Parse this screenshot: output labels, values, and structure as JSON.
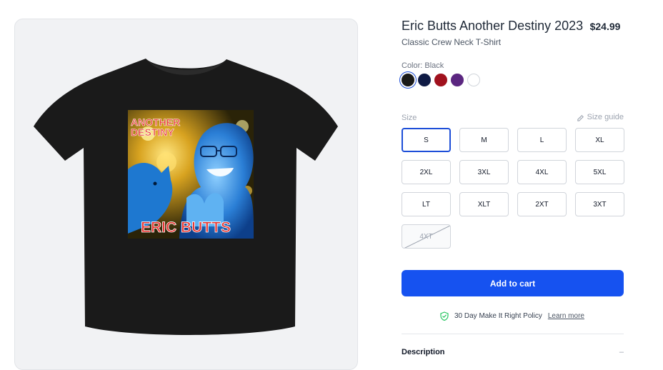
{
  "product": {
    "title": "Eric Butts Another Destiny 2023",
    "price": "$24.99",
    "subtitle": "Classic Crew Neck T-Shirt",
    "image_alt_text": "ANOTHER DESTINY / ERIC BUTTS shirt print"
  },
  "color": {
    "label": "Color: Black",
    "swatches": [
      {
        "name": "Black",
        "hex": "#1a1a1a",
        "selected": true
      },
      {
        "name": "Navy",
        "hex": "#0f1b45",
        "selected": false
      },
      {
        "name": "Red",
        "hex": "#a0111d",
        "selected": false
      },
      {
        "name": "Purple",
        "hex": "#5b2680",
        "selected": false
      },
      {
        "name": "White",
        "hex": "#ffffff",
        "selected": false
      }
    ]
  },
  "size": {
    "label": "Size",
    "guide_label": "Size guide",
    "options": [
      {
        "label": "S",
        "selected": true,
        "available": true
      },
      {
        "label": "M",
        "selected": false,
        "available": true
      },
      {
        "label": "L",
        "selected": false,
        "available": true
      },
      {
        "label": "XL",
        "selected": false,
        "available": true
      },
      {
        "label": "2XL",
        "selected": false,
        "available": true
      },
      {
        "label": "3XL",
        "selected": false,
        "available": true
      },
      {
        "label": "4XL",
        "selected": false,
        "available": true
      },
      {
        "label": "5XL",
        "selected": false,
        "available": true
      },
      {
        "label": "LT",
        "selected": false,
        "available": true
      },
      {
        "label": "XLT",
        "selected": false,
        "available": true
      },
      {
        "label": "2XT",
        "selected": false,
        "available": true
      },
      {
        "label": "3XT",
        "selected": false,
        "available": true
      },
      {
        "label": "4XT",
        "selected": false,
        "available": false
      }
    ]
  },
  "actions": {
    "add_to_cart": "Add to cart"
  },
  "policy": {
    "text": "30 Day Make It Right Policy",
    "link": "Learn more",
    "icon": "shield-check-icon"
  },
  "description": {
    "label": "Description",
    "toggle": "–"
  },
  "colors": {
    "accent": "#1652f0",
    "selected_outline": "#1d4ed8",
    "policy_icon": "#22c55e"
  },
  "print_text": {
    "top": [
      "ANOTHER",
      "DESTINY"
    ],
    "bottom": "ERIC BUTTS"
  }
}
